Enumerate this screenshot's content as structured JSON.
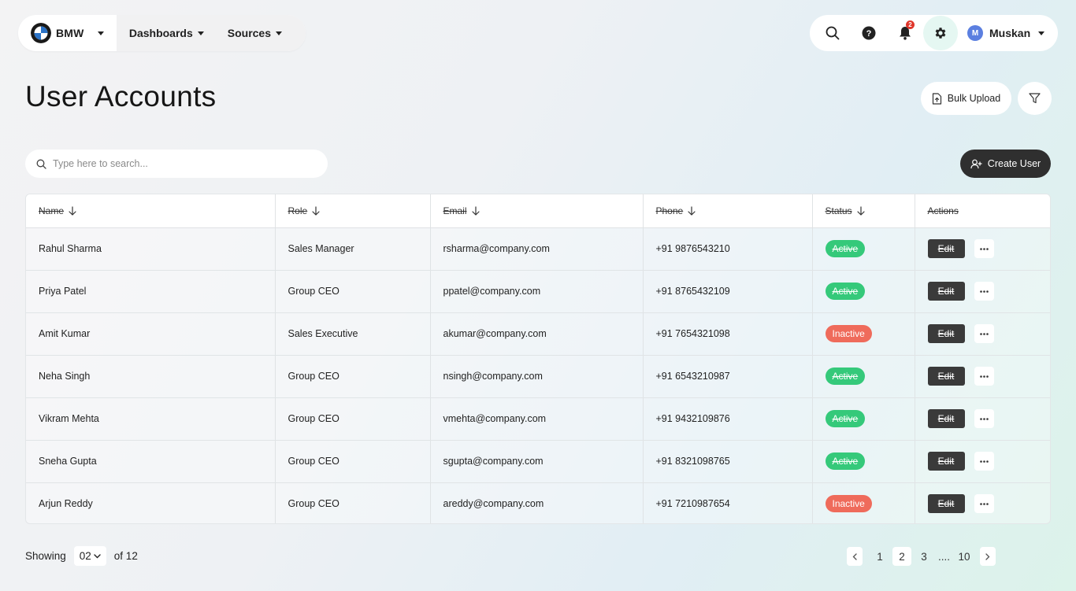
{
  "nav": {
    "brand": "BMW",
    "menu": [
      "Dashboards",
      "Sources"
    ],
    "notification_count": "2",
    "user_initial": "M",
    "user_name": "Muskan"
  },
  "page": {
    "title": "User Accounts",
    "bulk_upload_label": "Bulk Upload",
    "search_placeholder": "Type here to search...",
    "create_user_label": "Create User"
  },
  "table": {
    "headers": [
      "Name",
      "Role",
      "Email",
      "Phone",
      "Status",
      "Actions"
    ],
    "rows": [
      {
        "name": "Rahul Sharma",
        "role": "Sales Manager",
        "email": "rsharma@company.com",
        "phone": "+91 9876543210",
        "status": "Active"
      },
      {
        "name": "Priya Patel",
        "role": "Group CEO",
        "email": "ppatel@company.com",
        "phone": "+91 8765432109",
        "status": "Active"
      },
      {
        "name": "Amit Kumar",
        "role": "Sales Executive",
        "email": "akumar@company.com",
        "phone": "+91 7654321098",
        "status": "Inactive"
      },
      {
        "name": "Neha Singh",
        "role": "Group CEO",
        "email": "nsingh@company.com",
        "phone": "+91 6543210987",
        "status": "Active"
      },
      {
        "name": "Vikram Mehta",
        "role": "Group CEO",
        "email": "vmehta@company.com",
        "phone": "+91 9432109876",
        "status": "Active"
      },
      {
        "name": "Sneha Gupta",
        "role": "Group CEO",
        "email": "sgupta@company.com",
        "phone": "+91 8321098765",
        "status": "Active"
      },
      {
        "name": "Arjun Reddy",
        "role": "Group CEO",
        "email": "areddy@company.com",
        "phone": "+91 7210987654",
        "status": "Inactive"
      }
    ],
    "edit_label": "Edit"
  },
  "footer": {
    "showing_label": "Showing",
    "per_page": "02",
    "of_label": "of 12",
    "pages": [
      "1",
      "2",
      "3"
    ],
    "current_page": "2",
    "ellipsis": "....",
    "last_page": "10"
  },
  "colors": {
    "active": "#35c97a",
    "inactive": "#ef6b5b",
    "dark_button": "#2f2f2f",
    "badge": "#e0362b",
    "avatar": "#5b7fe0"
  }
}
